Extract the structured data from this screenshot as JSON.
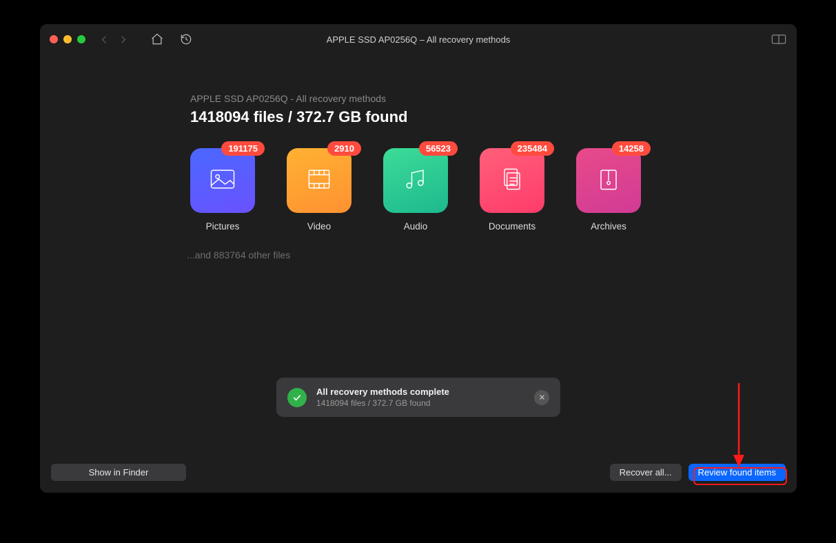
{
  "window": {
    "title": "APPLE SSD AP0256Q – All recovery methods"
  },
  "summary": {
    "subtitle": "APPLE SSD AP0256Q - All recovery methods",
    "headline": "1418094 files / 372.7 GB found",
    "other_files": "...and 883764 other files"
  },
  "categories": [
    {
      "key": "pictures",
      "label": "Pictures",
      "count": "191175"
    },
    {
      "key": "video",
      "label": "Video",
      "count": "2910"
    },
    {
      "key": "audio",
      "label": "Audio",
      "count": "56523"
    },
    {
      "key": "documents",
      "label": "Documents",
      "count": "235484"
    },
    {
      "key": "archives",
      "label": "Archives",
      "count": "14258"
    }
  ],
  "toast": {
    "title": "All recovery methods complete",
    "subtitle": "1418094 files / 372.7 GB found"
  },
  "footer": {
    "show_in_finder": "Show in Finder",
    "recover_all": "Recover all...",
    "review": "Review found items"
  }
}
